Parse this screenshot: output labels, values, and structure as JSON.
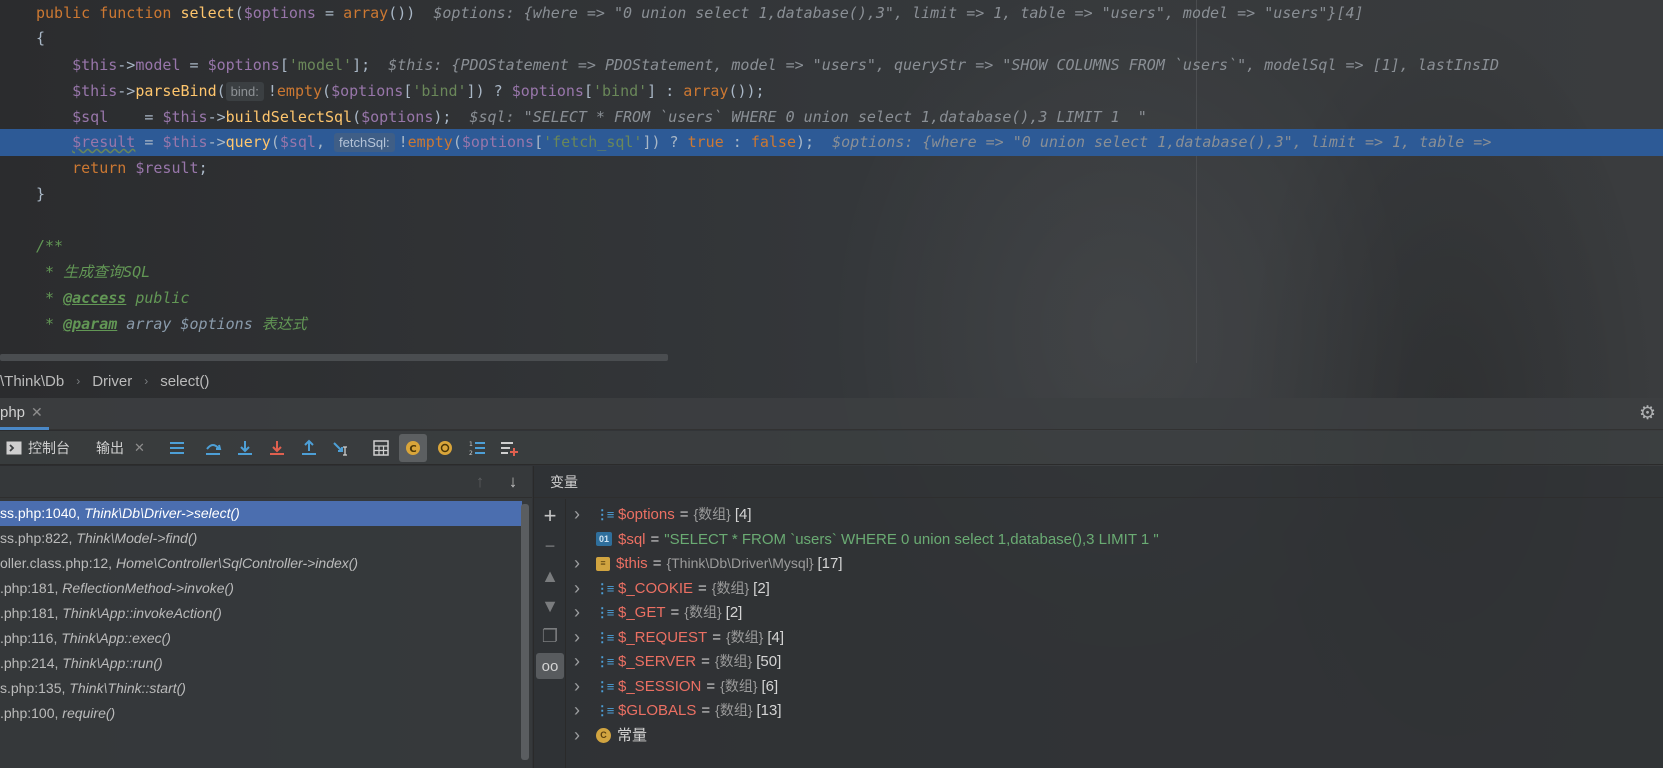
{
  "editor": {
    "lines": [
      {
        "id": "l1",
        "parts": [
          {
            "c": "kw",
            "t": "public function "
          },
          {
            "c": "fn",
            "t": "select"
          },
          {
            "c": "plain",
            "t": "("
          },
          {
            "c": "var",
            "t": "$options"
          },
          {
            "c": "plain",
            "t": " = "
          },
          {
            "c": "kw",
            "t": "array"
          },
          {
            "c": "plain",
            "t": "())"
          },
          {
            "c": "hint",
            "t": "  $options: {where => \"0 union select 1,database(),3\", limit => 1, table => \"users\", model => \"users\"}[4]"
          }
        ]
      },
      {
        "id": "l2",
        "parts": [
          {
            "c": "plain",
            "t": "{"
          }
        ]
      },
      {
        "id": "l3",
        "parts": [
          {
            "c": "plain",
            "t": "    "
          },
          {
            "c": "var",
            "t": "$this"
          },
          {
            "c": "plain",
            "t": "->"
          },
          {
            "c": "prop",
            "t": "model"
          },
          {
            "c": "plain",
            "t": " = "
          },
          {
            "c": "var",
            "t": "$options"
          },
          {
            "c": "plain",
            "t": "["
          },
          {
            "c": "str",
            "t": "'model'"
          },
          {
            "c": "plain",
            "t": "];"
          },
          {
            "c": "hint",
            "t": "  $this: {PDOStatement => PDOStatement, model => \"users\", queryStr => \"SHOW COLUMNS FROM `users`\", modelSql => [1], lastInsID"
          }
        ]
      },
      {
        "id": "l4",
        "parts": [
          {
            "c": "plain",
            "t": "    "
          },
          {
            "c": "var",
            "t": "$this"
          },
          {
            "c": "plain",
            "t": "->"
          },
          {
            "c": "fn",
            "t": "parseBind"
          },
          {
            "c": "plain",
            "t": "("
          },
          {
            "c": "param-hint",
            "t": "bind:"
          },
          {
            "c": "plain",
            "t": "!"
          },
          {
            "c": "kw",
            "t": "empty"
          },
          {
            "c": "plain",
            "t": "("
          },
          {
            "c": "var",
            "t": "$options"
          },
          {
            "c": "plain",
            "t": "["
          },
          {
            "c": "str",
            "t": "'bind'"
          },
          {
            "c": "plain",
            "t": "]) ? "
          },
          {
            "c": "var",
            "t": "$options"
          },
          {
            "c": "plain",
            "t": "["
          },
          {
            "c": "str",
            "t": "'bind'"
          },
          {
            "c": "plain",
            "t": "] : "
          },
          {
            "c": "kw",
            "t": "array"
          },
          {
            "c": "plain",
            "t": "());"
          }
        ]
      },
      {
        "id": "l5",
        "parts": [
          {
            "c": "plain",
            "t": "    "
          },
          {
            "c": "var",
            "t": "$sql"
          },
          {
            "c": "plain",
            "t": "    = "
          },
          {
            "c": "var",
            "t": "$this"
          },
          {
            "c": "plain",
            "t": "->"
          },
          {
            "c": "fn",
            "t": "buildSelectSql"
          },
          {
            "c": "plain",
            "t": "("
          },
          {
            "c": "var",
            "t": "$options"
          },
          {
            "c": "plain",
            "t": ");"
          },
          {
            "c": "hint",
            "t": "  $sql: \"SELECT * FROM `users` WHERE 0 union select 1,database(),3 LIMIT 1  \""
          }
        ]
      },
      {
        "id": "l6",
        "current": true,
        "parts": [
          {
            "c": "plain",
            "t": "    "
          },
          {
            "c": "var underline-warn",
            "t": "$result"
          },
          {
            "c": "plain",
            "t": " = "
          },
          {
            "c": "var",
            "t": "$this"
          },
          {
            "c": "plain",
            "t": "->"
          },
          {
            "c": "fn",
            "t": "query"
          },
          {
            "c": "plain",
            "t": "("
          },
          {
            "c": "var",
            "t": "$sql"
          },
          {
            "c": "plain",
            "t": ", "
          },
          {
            "c": "param-hint",
            "t": "fetchSql:"
          },
          {
            "c": "plain",
            "t": "!"
          },
          {
            "c": "kw",
            "t": "empty"
          },
          {
            "c": "plain",
            "t": "("
          },
          {
            "c": "var",
            "t": "$options"
          },
          {
            "c": "plain",
            "t": "["
          },
          {
            "c": "str",
            "t": "'fetch_sql'"
          },
          {
            "c": "plain",
            "t": "]) ? "
          },
          {
            "c": "kw",
            "t": "true"
          },
          {
            "c": "plain",
            "t": " : "
          },
          {
            "c": "kw",
            "t": "false"
          },
          {
            "c": "plain",
            "t": ");"
          },
          {
            "c": "hint",
            "t": "  $options: {where => \"0 union select 1,database(),3\", limit => 1, table =>"
          }
        ]
      },
      {
        "id": "l7",
        "parts": [
          {
            "c": "plain",
            "t": "    "
          },
          {
            "c": "kw",
            "t": "return "
          },
          {
            "c": "var",
            "t": "$result"
          },
          {
            "c": "plain",
            "t": ";"
          }
        ]
      },
      {
        "id": "l8",
        "parts": [
          {
            "c": "plain",
            "t": "}"
          }
        ]
      },
      {
        "id": "l9",
        "parts": [
          {
            "c": "plain",
            "t": ""
          }
        ]
      },
      {
        "id": "l10",
        "parts": [
          {
            "c": "comment",
            "t": "/**"
          }
        ]
      },
      {
        "id": "l11",
        "parts": [
          {
            "c": "comment",
            "t": " * "
          },
          {
            "c": "comment cjk",
            "t": "生成查询"
          },
          {
            "c": "comment",
            "t": "SQL"
          }
        ]
      },
      {
        "id": "l12",
        "parts": [
          {
            "c": "comment",
            "t": " * "
          },
          {
            "c": "doctag",
            "t": "@access"
          },
          {
            "c": "comment",
            "t": " public"
          }
        ]
      },
      {
        "id": "l13",
        "parts": [
          {
            "c": "comment",
            "t": " * "
          },
          {
            "c": "doctag",
            "t": "@param"
          },
          {
            "c": "docval",
            "t": " array $options "
          },
          {
            "c": "comment cjk",
            "t": "表达式"
          }
        ]
      }
    ]
  },
  "breadcrumb": [
    "\\Think\\Db",
    "Driver",
    "select()"
  ],
  "debug_tab": {
    "label": "php"
  },
  "toolbar": {
    "console": "控制台",
    "output": "输出"
  },
  "frames": [
    {
      "loc": "ss.php:1040, ",
      "meth": "Think\\Db\\Driver->select()",
      "selected": true
    },
    {
      "loc": "ss.php:822, ",
      "meth": "Think\\Model->find()"
    },
    {
      "loc": "oller.class.php:12, ",
      "meth": "Home\\Controller\\SqlController->index()"
    },
    {
      "loc": ".php:181, ",
      "meth": "ReflectionMethod->invoke()"
    },
    {
      "loc": ".php:181, ",
      "meth": "Think\\App::invokeAction()"
    },
    {
      "loc": ".php:116, ",
      "meth": "Think\\App::exec()"
    },
    {
      "loc": ".php:214, ",
      "meth": "Think\\App::run()"
    },
    {
      "loc": "s.php:135, ",
      "meth": "Think\\Think::start()"
    },
    {
      "loc": ".php:100, ",
      "meth": "require()"
    }
  ],
  "variables": {
    "title": "变量",
    "items": [
      {
        "icon": "arr",
        "name": "$options",
        "type": "{数组}",
        "count": "[4]",
        "expand": true
      },
      {
        "icon": "o1",
        "name": "$sql",
        "str": "\"SELECT * FROM `users` WHERE 0 union select 1,database(),3 LIMIT 1  \"",
        "expand": false
      },
      {
        "icon": "obj",
        "name": "$this",
        "type": "{Think\\Db\\Driver\\Mysql}",
        "count": "[17]",
        "expand": true
      },
      {
        "icon": "arr",
        "name": "$_COOKIE",
        "type": "{数组}",
        "count": "[2]",
        "expand": true
      },
      {
        "icon": "arr",
        "name": "$_GET",
        "type": "{数组}",
        "count": "[2]",
        "expand": true
      },
      {
        "icon": "arr",
        "name": "$_REQUEST",
        "type": "{数组}",
        "count": "[4]",
        "expand": true
      },
      {
        "icon": "arr",
        "name": "$_SERVER",
        "type": "{数组}",
        "count": "[50]",
        "expand": true
      },
      {
        "icon": "arr",
        "name": "$_SESSION",
        "type": "{数组}",
        "count": "[6]",
        "expand": true
      },
      {
        "icon": "arr",
        "name": "$GLOBALS",
        "type": "{数组}",
        "count": "[13]",
        "expand": true
      },
      {
        "icon": "const",
        "name": "常量",
        "plain": true,
        "expand": true
      }
    ]
  }
}
